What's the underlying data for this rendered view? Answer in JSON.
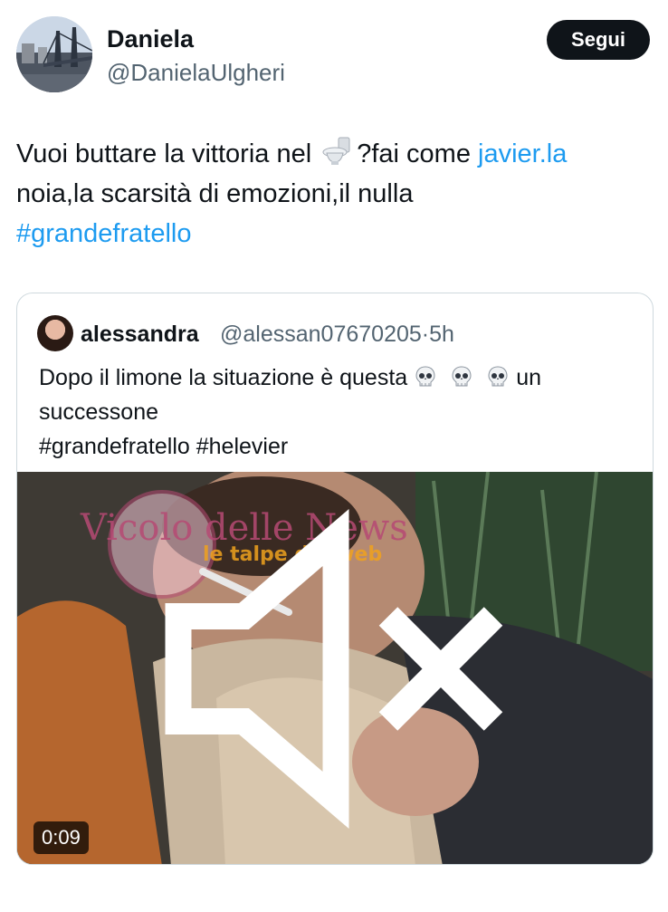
{
  "author": {
    "name": "Daniela",
    "handle": "@DanielaUlgheri",
    "avatar_icon": "profile-photo-bridge"
  },
  "follow_label": "Segui",
  "tweet": {
    "part1": "Vuoi buttare la vittoria nel",
    "emoji_icon": "toilet-emoji",
    "part2": "?fai come ",
    "mention": "javier.la",
    "line2": "noia,la scarsità di emozioni,il nulla",
    "hashtag": "#grandefratello"
  },
  "quoted": {
    "name": "alessandra",
    "meta": "@alessan07670205·5h",
    "line1": "Dopo il limone la situazione è questa",
    "emoji_icon": "skull-emoji",
    "line1_end": "un",
    "line2": "successone",
    "line3": "#grandefratello #helevier"
  },
  "media": {
    "duration": "0:09",
    "watermarks": [
      "Vicolo delle News",
      "le talpe del web"
    ],
    "mute_icon": "speaker-muted-icon"
  },
  "colors": {
    "link": "#1d9bf0",
    "text": "#0f1419",
    "secondary": "#536471",
    "border": "#cfd9de"
  }
}
